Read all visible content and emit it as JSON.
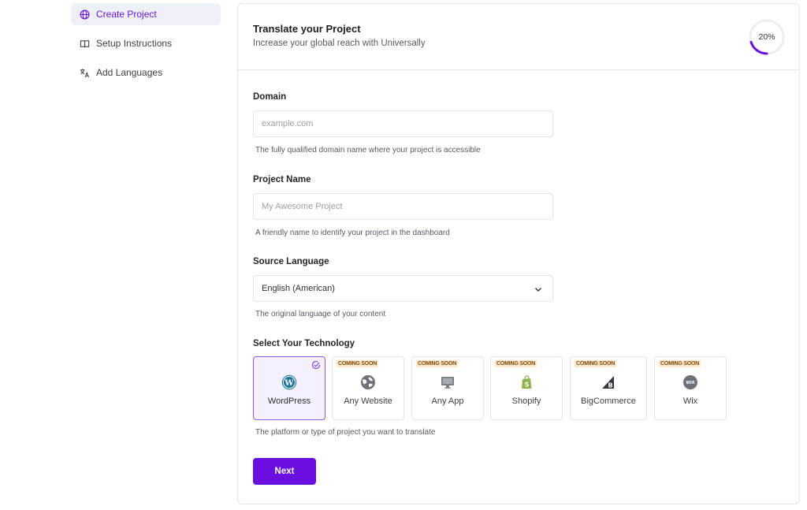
{
  "sidebar": {
    "items": [
      {
        "label": "Create Project",
        "icon": "globe-icon",
        "active": true
      },
      {
        "label": "Setup Instructions",
        "icon": "book-icon",
        "active": false
      },
      {
        "label": "Add Languages",
        "icon": "translate-icon",
        "active": false
      }
    ]
  },
  "header": {
    "title": "Translate your Project",
    "subtitle": "Increase your global reach with Universally",
    "progress_label": "20%",
    "progress_value": 0.2
  },
  "form": {
    "domain": {
      "label": "Domain",
      "placeholder": "example.com",
      "value": "",
      "help": "The fully qualified domain name where your project is accessible"
    },
    "project_name": {
      "label": "Project Name",
      "placeholder": "My Awesome Project",
      "value": "",
      "help": "A friendly name to identify your project in the dashboard"
    },
    "source_language": {
      "label": "Source Language",
      "value": "English (American)",
      "help": "The original language of your content"
    },
    "technology": {
      "label": "Select Your Technology",
      "help": "The platform or type of project you want to translate",
      "options": [
        {
          "name": "WordPress",
          "badge": "",
          "selected": true,
          "icon": "wordpress-icon"
        },
        {
          "name": "Any Website",
          "badge": "COMING SOON",
          "selected": false,
          "icon": "world-icon"
        },
        {
          "name": "Any App",
          "badge": "COMING SOON",
          "selected": false,
          "icon": "monitor-icon"
        },
        {
          "name": "Shopify",
          "badge": "COMING SOON",
          "selected": false,
          "icon": "shopify-icon"
        },
        {
          "name": "BigCommerce",
          "badge": "COMING SOON",
          "selected": false,
          "icon": "bigcommerce-icon"
        },
        {
          "name": "Wix",
          "badge": "COMING SOON",
          "selected": false,
          "icon": "wix-icon"
        }
      ]
    },
    "next_label": "Next"
  },
  "colors": {
    "accent": "#6a0fe0",
    "active_nav_bg": "#eef0f8",
    "badge_bg": "#fde8c9"
  }
}
